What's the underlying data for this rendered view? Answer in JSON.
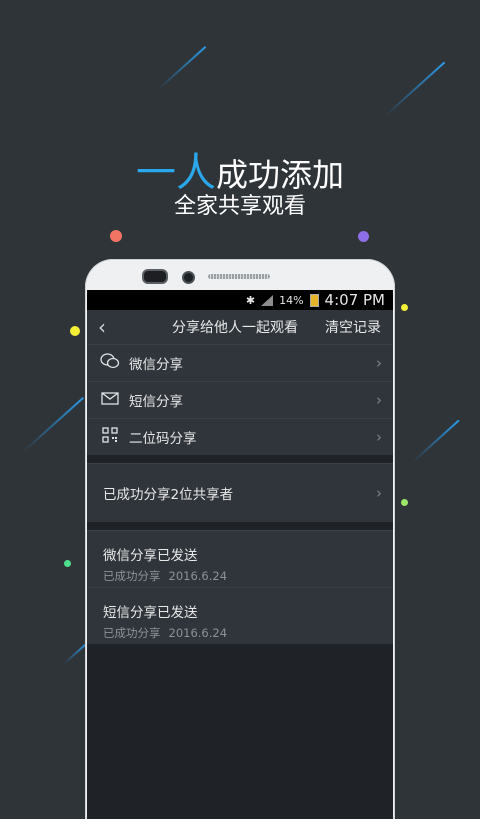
{
  "promo": {
    "accent": "一人",
    "headline_rest": "成功添加",
    "subline": "全家共享观看"
  },
  "status_bar": {
    "battery": "14%",
    "time": "4:07 PM"
  },
  "header": {
    "back_icon": "chevron-left-icon",
    "title": "分享给他人一起观看",
    "clear_label": "清空记录"
  },
  "share_options": [
    {
      "icon": "wechat-icon",
      "label": "微信分享"
    },
    {
      "icon": "mail-icon",
      "label": "短信分享"
    },
    {
      "icon": "qrcode-icon",
      "label": "二位码分享"
    }
  ],
  "shared_summary": {
    "label": "已成功分享2位共享者"
  },
  "records": [
    {
      "title": "微信分享已发送",
      "status": "已成功分享",
      "date": "2016.6.24"
    },
    {
      "title": "短信分享已发送",
      "status": "已成功分享",
      "date": "2016.6.24"
    }
  ],
  "colors": {
    "background": "#2f3439",
    "accent": "#2ba7ec",
    "panel": "#2f353b"
  }
}
